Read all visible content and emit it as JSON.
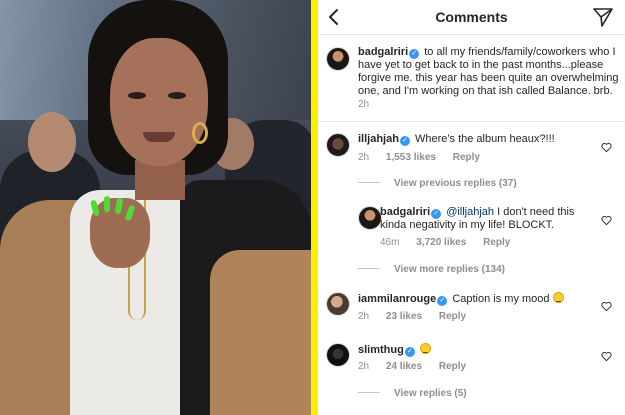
{
  "header": {
    "title": "Comments"
  },
  "caption": {
    "username": "badgalriri",
    "text": "to all my friends/family/coworkers who I have yet to get back to in the past months...please forgive me. this year has been quite an overwhelming one, and I'm working on that ish called Balance. brb.",
    "time": "2h"
  },
  "comments": [
    {
      "username": "illjahjah",
      "text": "Where's the album heaux?!!!",
      "time": "2h",
      "likes": "1,553 likes",
      "reply_label": "Reply",
      "view_replies": "View previous replies (37)"
    },
    {
      "username": "badgalriri",
      "mention": "@illjahjah",
      "text": "I don't need this kinda negativity in my life! BLOCKT.",
      "time": "46m",
      "likes": "3,720 likes",
      "reply_label": "Reply",
      "view_replies": "View more replies (134)"
    },
    {
      "username": "iammilanrouge",
      "text": "Caption is my mood",
      "emoji": "weary-face",
      "time": "2h",
      "likes": "23 likes",
      "reply_label": "Reply"
    },
    {
      "username": "slimthug",
      "text": "",
      "emoji": "grinning-face",
      "time": "2h",
      "likes": "24 likes",
      "reply_label": "Reply",
      "view_replies": "View replies (5)"
    }
  ],
  "colors": {
    "divider": "#fff000",
    "verified": "#3897f0",
    "meta_gray": "#8e8e8e",
    "mention": "#00376b"
  }
}
